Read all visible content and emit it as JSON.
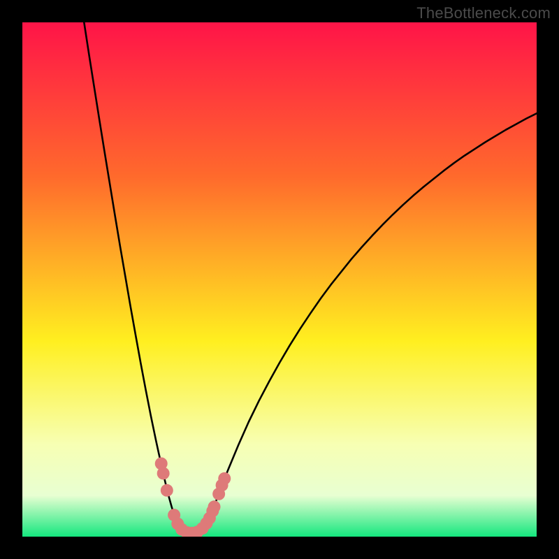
{
  "watermark": "TheBottleneck.com",
  "colors": {
    "frame": "#000000",
    "gradient_top": "#ff1448",
    "gradient_upper_mid": "#ff6a2c",
    "gradient_mid": "#ffef20",
    "gradient_low": "#f7ffb3",
    "gradient_band": "#e8ffd2",
    "gradient_bottom": "#14e77e",
    "curve_stroke": "#000000",
    "marker_fill": "#de7a79"
  },
  "chart_data": {
    "type": "line",
    "title": "",
    "xlabel": "",
    "ylabel": "",
    "xlim": [
      0,
      100
    ],
    "ylim": [
      0,
      100
    ],
    "curve": [
      {
        "x": 12.0,
        "y": 100.0
      },
      {
        "x": 13.0,
        "y": 93.5
      },
      {
        "x": 14.0,
        "y": 87.2
      },
      {
        "x": 15.0,
        "y": 80.9
      },
      {
        "x": 16.0,
        "y": 74.7
      },
      {
        "x": 17.0,
        "y": 68.6
      },
      {
        "x": 18.0,
        "y": 62.5
      },
      {
        "x": 19.0,
        "y": 56.5
      },
      {
        "x": 20.0,
        "y": 50.7
      },
      {
        "x": 21.0,
        "y": 44.9
      },
      {
        "x": 22.0,
        "y": 39.3
      },
      {
        "x": 23.0,
        "y": 33.8
      },
      {
        "x": 24.0,
        "y": 28.5
      },
      {
        "x": 25.0,
        "y": 23.4
      },
      {
        "x": 26.0,
        "y": 18.6
      },
      {
        "x": 26.5,
        "y": 16.3
      },
      {
        "x": 27.0,
        "y": 14.1
      },
      {
        "x": 27.5,
        "y": 11.8
      },
      {
        "x": 28.0,
        "y": 9.7
      },
      {
        "x": 28.5,
        "y": 7.7
      },
      {
        "x": 29.0,
        "y": 5.9
      },
      {
        "x": 29.5,
        "y": 4.3
      },
      {
        "x": 30.0,
        "y": 3.0
      },
      {
        "x": 30.5,
        "y": 2.0
      },
      {
        "x": 31.0,
        "y": 1.3
      },
      {
        "x": 31.5,
        "y": 0.8
      },
      {
        "x": 32.0,
        "y": 0.5
      },
      {
        "x": 32.5,
        "y": 0.3
      },
      {
        "x": 33.0,
        "y": 0.2
      },
      {
        "x": 33.5,
        "y": 0.3
      },
      {
        "x": 34.0,
        "y": 0.5
      },
      {
        "x": 34.5,
        "y": 0.8
      },
      {
        "x": 35.0,
        "y": 1.3
      },
      {
        "x": 35.5,
        "y": 2.0
      },
      {
        "x": 36.0,
        "y": 2.9
      },
      {
        "x": 36.5,
        "y": 4.0
      },
      {
        "x": 37.0,
        "y": 5.2
      },
      {
        "x": 37.5,
        "y": 6.5
      },
      {
        "x": 38.0,
        "y": 7.8
      },
      {
        "x": 39.0,
        "y": 10.4
      },
      {
        "x": 40.0,
        "y": 13.0
      },
      {
        "x": 42.0,
        "y": 17.8
      },
      {
        "x": 44.0,
        "y": 22.3
      },
      {
        "x": 46.0,
        "y": 26.4
      },
      {
        "x": 48.0,
        "y": 30.2
      },
      {
        "x": 50.0,
        "y": 33.8
      },
      {
        "x": 52.0,
        "y": 37.2
      },
      {
        "x": 54.0,
        "y": 40.4
      },
      {
        "x": 56.0,
        "y": 43.4
      },
      {
        "x": 58.0,
        "y": 46.3
      },
      {
        "x": 60.0,
        "y": 49.0
      },
      {
        "x": 62.0,
        "y": 51.5
      },
      {
        "x": 64.0,
        "y": 54.0
      },
      {
        "x": 66.0,
        "y": 56.3
      },
      {
        "x": 68.0,
        "y": 58.5
      },
      {
        "x": 70.0,
        "y": 60.6
      },
      {
        "x": 72.0,
        "y": 62.6
      },
      {
        "x": 74.0,
        "y": 64.5
      },
      {
        "x": 76.0,
        "y": 66.3
      },
      {
        "x": 78.0,
        "y": 68.0
      },
      {
        "x": 80.0,
        "y": 69.6
      },
      {
        "x": 82.0,
        "y": 71.2
      },
      {
        "x": 84.0,
        "y": 72.7
      },
      {
        "x": 86.0,
        "y": 74.1
      },
      {
        "x": 88.0,
        "y": 75.4
      },
      {
        "x": 90.0,
        "y": 76.7
      },
      {
        "x": 92.0,
        "y": 77.9
      },
      {
        "x": 94.0,
        "y": 79.1
      },
      {
        "x": 96.0,
        "y": 80.2
      },
      {
        "x": 98.0,
        "y": 81.3
      },
      {
        "x": 100.0,
        "y": 82.3
      }
    ],
    "markers": [
      {
        "x": 27.0,
        "y": 14.2
      },
      {
        "x": 27.4,
        "y": 12.3
      },
      {
        "x": 28.1,
        "y": 9.0
      },
      {
        "x": 29.5,
        "y": 4.2
      },
      {
        "x": 30.2,
        "y": 2.5
      },
      {
        "x": 31.0,
        "y": 1.4
      },
      {
        "x": 32.0,
        "y": 0.8
      },
      {
        "x": 33.0,
        "y": 0.7
      },
      {
        "x": 34.0,
        "y": 0.9
      },
      {
        "x": 35.0,
        "y": 1.6
      },
      {
        "x": 35.8,
        "y": 2.6
      },
      {
        "x": 36.4,
        "y": 3.6
      },
      {
        "x": 37.0,
        "y": 5.0
      },
      {
        "x": 37.3,
        "y": 5.8
      },
      {
        "x": 38.2,
        "y": 8.3
      },
      {
        "x": 38.8,
        "y": 10.0
      },
      {
        "x": 39.3,
        "y": 11.3
      }
    ]
  }
}
